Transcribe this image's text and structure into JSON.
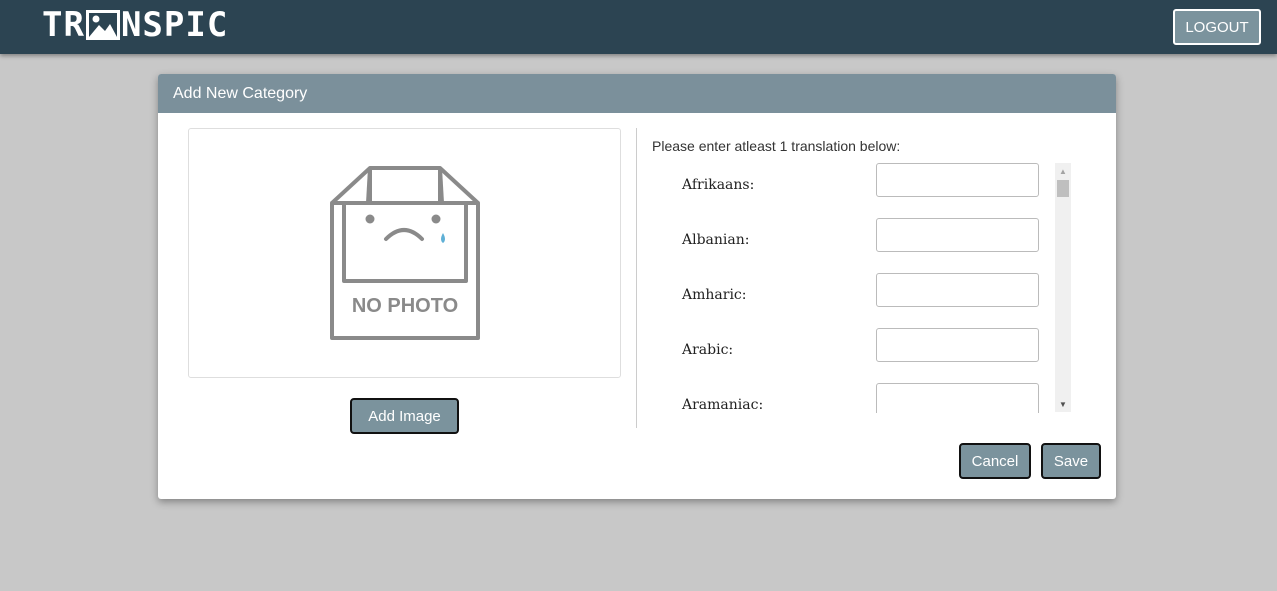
{
  "navbar": {
    "logo_text_left": "TR",
    "logo_text_right": "NSPIC",
    "logout_label": "LOGOUT"
  },
  "modal": {
    "title": "Add New Category",
    "image_placeholder_text": "NO PHOTO",
    "add_image_label": "Add Image",
    "instructions": "Please enter atleast 1 translation below:",
    "languages": [
      "Afrikaans:",
      "Albanian:",
      "Amharic:",
      "Arabic:",
      "Aramaniac:"
    ],
    "translation_values": [
      "",
      "",
      "",
      "",
      ""
    ],
    "cancel_label": "Cancel",
    "save_label": "Save"
  },
  "colors": {
    "navbar": "#2c4452",
    "header": "#7b909b",
    "button": "#7b939d",
    "background": "#c8c8c8"
  },
  "icons": {
    "logo_a": "picture-icon",
    "scroll_up": "triangle-up-icon",
    "scroll_down": "triangle-down-icon"
  }
}
